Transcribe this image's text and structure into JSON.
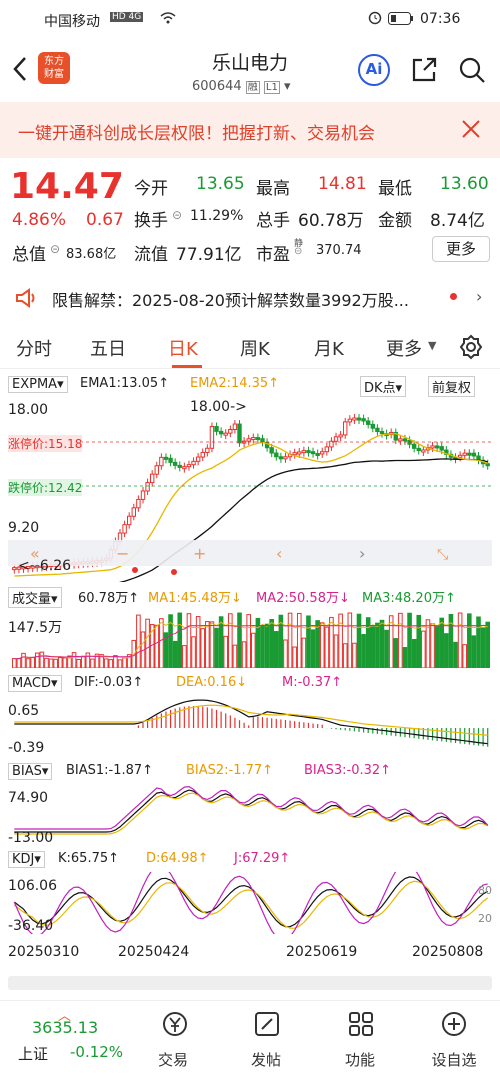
{
  "status": {
    "carrier": "中国移动",
    "net": "HD 4G",
    "time": "07:36"
  },
  "nav": {
    "logo_top": "东方",
    "logo_bottom": "财富",
    "title": "乐山电力",
    "code": "600644",
    "badge_rong": "融",
    "badge_level": "L1",
    "ai": "Ai"
  },
  "banner": {
    "text": "一键开通科创成长层权限！把握打新、交易机会"
  },
  "quote": {
    "price": "14.47",
    "pct": "4.86%",
    "chg": "0.67",
    "open_l": "今开",
    "open_v": "13.65",
    "high_l": "最高",
    "high_v": "14.81",
    "low_l": "最低",
    "low_v": "13.60",
    "turn_l": "换手",
    "turn_v": "11.29%",
    "vol_l": "总手",
    "vol_v": "60.78万",
    "amt_l": "金额",
    "amt_v": "8.74亿",
    "mcap_l": "总值",
    "mcap_v": "83.68亿",
    "float_l": "流值",
    "float_v": "77.91亿",
    "pe_l": "市盈",
    "pe_tag": "静",
    "pe_v": "370.74",
    "more": "更多"
  },
  "notice": {
    "text": "限售解禁：2025-08-20预计解禁数量3992万股..."
  },
  "tabs": [
    "分时",
    "五日",
    "日K",
    "周K",
    "月K",
    "更多"
  ],
  "kline": {
    "indicator": "EXPMA",
    "ema1": "EMA1:13.05↑",
    "ema2": "EMA2:14.35↑",
    "dk": "DK点",
    "fq": "前复权",
    "y_top": "18.00",
    "y_mid": "9.20",
    "limit_up": "涨停价:15.18",
    "limit_down": "跌停价:12.42",
    "max_mark": "18.00->",
    "min_mark": "<--6.26"
  },
  "volume": {
    "title": "成交量",
    "v": "60.78万↑",
    "ma1": "MA1:45.48万↓",
    "ma2": "MA2:50.58万↓",
    "ma3": "MA3:48.20万↑",
    "y_top": "147.5万"
  },
  "macd": {
    "title": "MACD",
    "dif": "DIF:-0.03↑",
    "dea": "DEA:0.16↓",
    "m": "M:-0.37↑",
    "y_top": "0.65",
    "y_bot": "-0.39"
  },
  "bias": {
    "title": "BIAS",
    "b1": "BIAS1:-1.87↑",
    "b2": "BIAS2:-1.77↑",
    "b3": "BIAS3:-0.32↑",
    "y_top": "74.90",
    "y_bot": "-13.00"
  },
  "kdj": {
    "title": "KDJ",
    "k": "K:65.75↑",
    "d": "D:64.98↑",
    "j": "J:67.29↑",
    "y_top": "106.06",
    "y_bot": "-36.40",
    "r80": "80",
    "r20": "20"
  },
  "dates": [
    "20250310",
    "20250424",
    "20250619",
    "20250808"
  ],
  "bottom": {
    "index_val": "3635.13",
    "index_name": "上证",
    "index_pct": "-0.12%",
    "trade": "交易",
    "post": "发帖",
    "func": "功能",
    "custom": "设自选"
  }
}
